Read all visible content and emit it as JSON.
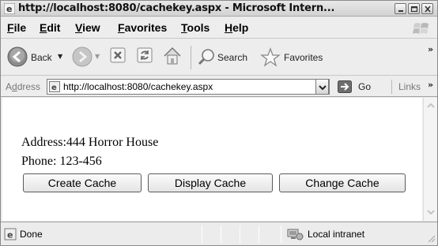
{
  "window": {
    "title": "http://localhost:8080/cachekey.aspx - Microsoft Intern..."
  },
  "menu": [
    "File",
    "Edit",
    "View",
    "Favorites",
    "Tools",
    "Help"
  ],
  "toolbar": {
    "back_label": "Back",
    "search_label": "Search",
    "favorites_label": "Favorites",
    "overflow": "»"
  },
  "address": {
    "label_prefix": "A",
    "label_underlined": "d",
    "label_suffix": "dress",
    "url": "http://localhost:8080/cachekey.aspx",
    "go_label": "Go",
    "links_label": "Links",
    "overflow": "»"
  },
  "page": {
    "address_line": "Address:444 Horror House",
    "phone_line": "Phone: 123-456",
    "buttons": [
      "Create Cache",
      "Display Cache",
      "Change Cache"
    ]
  },
  "status": {
    "text": "Done",
    "zone": "Local intranet"
  },
  "icons": {
    "back": "back-arrow-icon",
    "forward": "forward-arrow-icon",
    "stop": "stop-icon",
    "refresh": "refresh-icon",
    "home": "home-icon",
    "search": "search-magnifier-icon",
    "favorites": "favorites-star-icon"
  }
}
